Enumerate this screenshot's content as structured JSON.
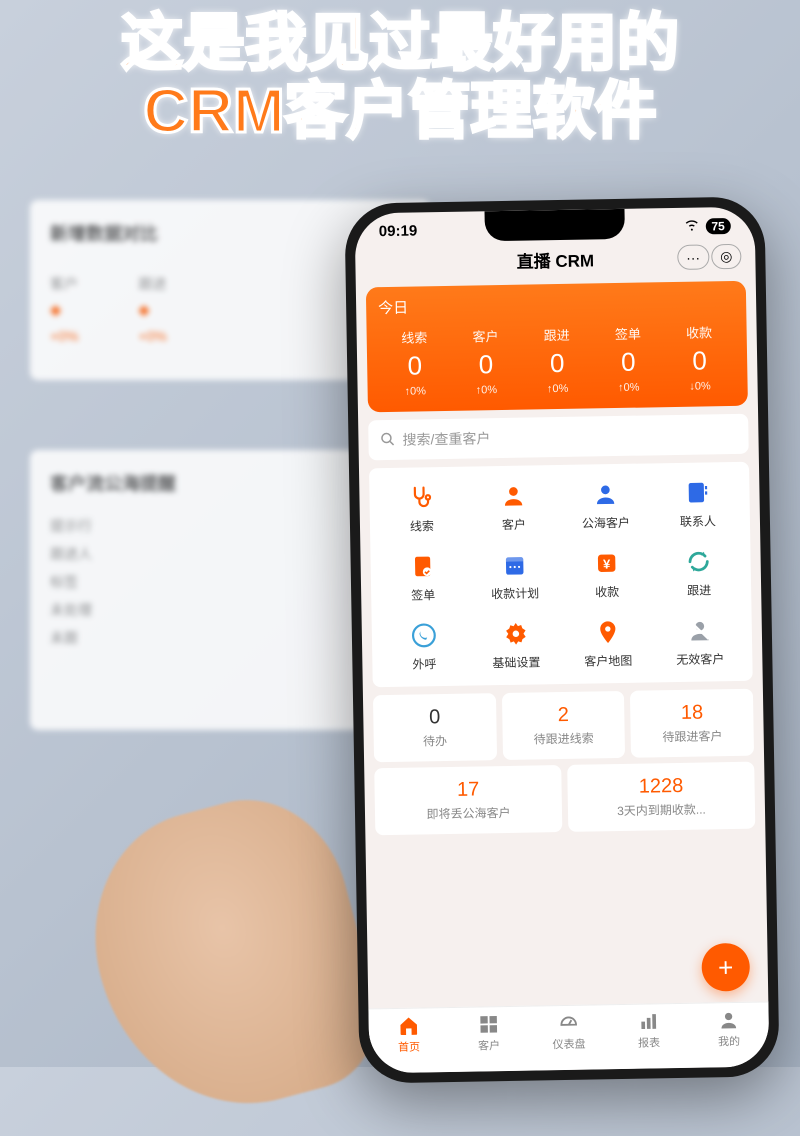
{
  "headline_l1": "这是我见过最好用的",
  "headline_l2": "CRM客户管理软件",
  "bg": {
    "card1_title": "新增数据对比",
    "card1_a": "客户",
    "card1_b": "跟进",
    "card2_title": "客户流公海提醒",
    "card2_items": [
      "提示行",
      "跟进人",
      "标签",
      "未处理",
      "未跟"
    ]
  },
  "status": {
    "time": "09:19",
    "battery": "75"
  },
  "app": {
    "title": "直播 CRM",
    "ctrl_dots": "···",
    "ctrl_target": "◎"
  },
  "dash": {
    "header": "今日",
    "cols": [
      {
        "label": "线索",
        "value": "0",
        "pct": "↑0%"
      },
      {
        "label": "客户",
        "value": "0",
        "pct": "↑0%"
      },
      {
        "label": "跟进",
        "value": "0",
        "pct": "↑0%"
      },
      {
        "label": "签单",
        "value": "0",
        "pct": "↑0%"
      },
      {
        "label": "收款",
        "value": "0",
        "pct": "↓0%"
      }
    ]
  },
  "search": {
    "placeholder": "搜索/查重客户",
    "icon": "🔍"
  },
  "grid": [
    {
      "label": "线索",
      "color": "#ff5a00",
      "icon": "stethoscope"
    },
    {
      "label": "客户",
      "color": "#ff5a00",
      "icon": "person"
    },
    {
      "label": "公海客户",
      "color": "#2e6ae6",
      "icon": "person-blue"
    },
    {
      "label": "联系人",
      "color": "#2e6ae6",
      "icon": "contact"
    },
    {
      "label": "签单",
      "color": "#ff5a00",
      "icon": "doc"
    },
    {
      "label": "收款计划",
      "color": "#2e6ae6",
      "icon": "calendar"
    },
    {
      "label": "收款",
      "color": "#ff5a00",
      "icon": "yuan"
    },
    {
      "label": "跟进",
      "color": "#2ea89a",
      "icon": "refresh"
    },
    {
      "label": "外呼",
      "color": "#3aa0d8",
      "icon": "phone"
    },
    {
      "label": "基础设置",
      "color": "#ff5a00",
      "icon": "gear"
    },
    {
      "label": "客户地图",
      "color": "#ff5a00",
      "icon": "pin"
    },
    {
      "label": "无效客户",
      "color": "#9aa0a8",
      "icon": "mute"
    }
  ],
  "stats": [
    {
      "value": "0",
      "label": "待办",
      "cls": "v-dk"
    },
    {
      "value": "2",
      "label": "待跟进线索",
      "cls": "v-or"
    },
    {
      "value": "18",
      "label": "待跟进客户",
      "cls": "v-or"
    },
    {
      "value": "17",
      "label": "即将丢公海客户",
      "cls": "v-or"
    },
    {
      "value": "1228",
      "label": "3天内到期收款...",
      "cls": "v-or"
    }
  ],
  "fab": "+",
  "nav": [
    {
      "label": "首页",
      "active": true,
      "icon": "home"
    },
    {
      "label": "客户",
      "active": false,
      "icon": "grid"
    },
    {
      "label": "仪表盘",
      "active": false,
      "icon": "dash"
    },
    {
      "label": "报表",
      "active": false,
      "icon": "chart"
    },
    {
      "label": "我的",
      "active": false,
      "icon": "user"
    }
  ]
}
